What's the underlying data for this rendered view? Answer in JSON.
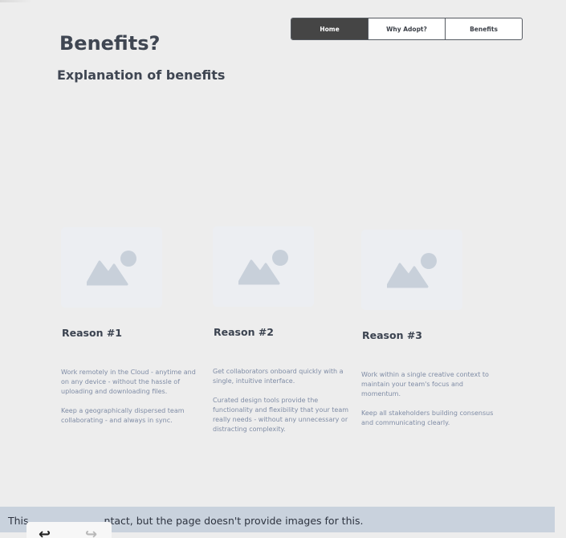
{
  "nav": {
    "tabs": [
      {
        "label": "Home",
        "active": true
      },
      {
        "label": "Why Adopt?",
        "active": false
      },
      {
        "label": "Benefits",
        "active": false
      }
    ]
  },
  "header": {
    "title": "Benefits?",
    "subtitle": "Explanation of benefits"
  },
  "cards": [
    {
      "reason": "Reason #1",
      "paragraphs": [
        "Work remotely in the Cloud - anytime and on any device - without the hassle of uploading and downloading files.",
        "Keep a geographically dispersed team collaborating - and always in sync."
      ]
    },
    {
      "reason": "Reason #2",
      "paragraphs": [
        "Get collaborators onboard quickly with a single, intuitive interface.",
        "Curated design tools provide the functionality and flexibility that your team really needs - without any unnecessary or distracting complexity."
      ]
    },
    {
      "reason": "Reason #3",
      "paragraphs": [
        "Work within a single creative context to maintain your team's focus and momentum.",
        "Keep all stakeholders  building consensus and communicating clearly."
      ]
    }
  ],
  "notice": {
    "text_start": "This",
    "text_end": "ntact, but the page doesn't provide images for this."
  },
  "browser": {
    "back_glyph": "↩",
    "forward_glyph": "↪"
  },
  "colors": {
    "active_tab": "#454545",
    "placeholder_bg": "#eceef2",
    "placeholder_icon": "#c8d0da",
    "notice_bg": "#c9d2dd"
  }
}
